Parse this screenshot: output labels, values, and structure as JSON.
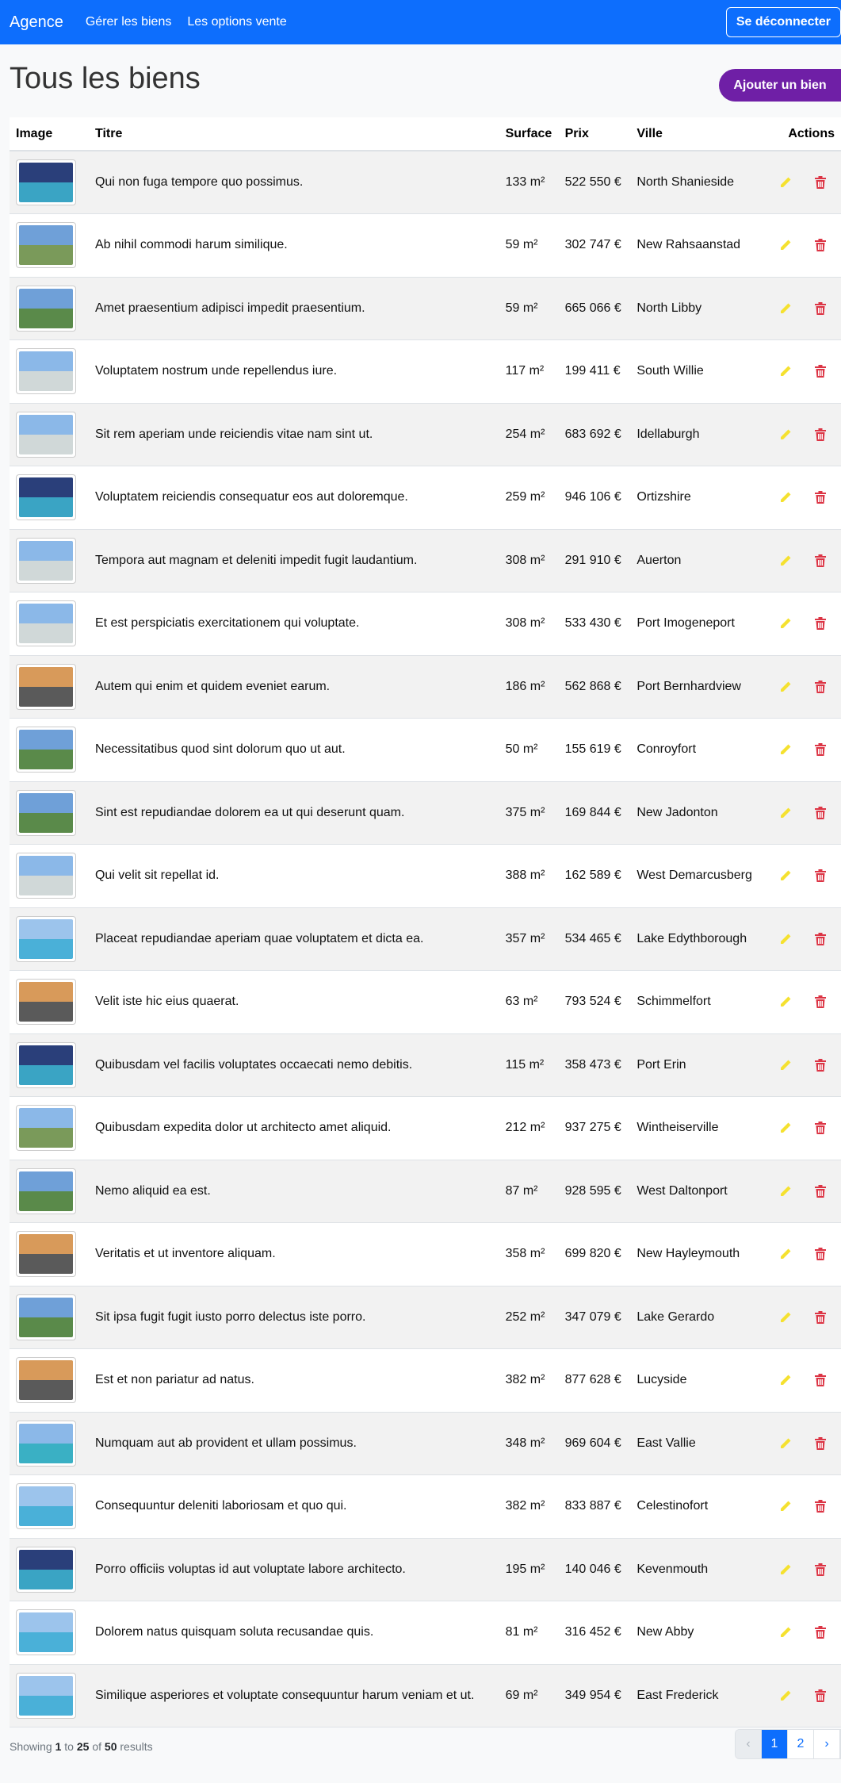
{
  "navbar": {
    "brand": "Agence",
    "links": [
      "Gérer les biens",
      "Les options vente"
    ],
    "logout_label": "Se déconnecter"
  },
  "page": {
    "title": "Tous les biens",
    "add_button": "Ajouter un bien"
  },
  "table": {
    "headers": [
      "Image",
      "Titre",
      "Surface",
      "Prix",
      "Ville",
      "Actions"
    ],
    "rows": [
      {
        "title": "Qui non fuga tempore quo possimus.",
        "surface": "133 m²",
        "price": "522 550 €",
        "city": "North Shanieside",
        "sky": "#2a3f7a",
        "ground": "#3aa4c4"
      },
      {
        "title": "Ab nihil commodi harum similique.",
        "surface": "59 m²",
        "price": "302 747 €",
        "city": "New Rahsaanstad",
        "sky": "#6fa0d8",
        "ground": "#7a9a5a"
      },
      {
        "title": "Amet praesentium adipisci impedit praesentium.",
        "surface": "59 m²",
        "price": "665 066 €",
        "city": "North Libby",
        "sky": "#6fa0d8",
        "ground": "#5a8a4a"
      },
      {
        "title": "Voluptatem nostrum unde repellendus iure.",
        "surface": "117 m²",
        "price": "199 411 €",
        "city": "South Willie",
        "sky": "#8bb8e8",
        "ground": "#d0d8d8"
      },
      {
        "title": "Sit rem aperiam unde reiciendis vitae nam sint ut.",
        "surface": "254 m²",
        "price": "683 692 €",
        "city": "Idellaburgh",
        "sky": "#8bb8e8",
        "ground": "#d0d8d8"
      },
      {
        "title": "Voluptatem reiciendis consequatur eos aut doloremque.",
        "surface": "259 m²",
        "price": "946 106 €",
        "city": "Ortizshire",
        "sky": "#2a3f7a",
        "ground": "#3aa4c4"
      },
      {
        "title": "Tempora aut magnam et deleniti impedit fugit laudantium.",
        "surface": "308 m²",
        "price": "291 910 €",
        "city": "Auerton",
        "sky": "#8bb8e8",
        "ground": "#d0d8d8"
      },
      {
        "title": "Et est perspiciatis exercitationem qui voluptate.",
        "surface": "308 m²",
        "price": "533 430 €",
        "city": "Port Imogeneport",
        "sky": "#8bb8e8",
        "ground": "#d0d8d8"
      },
      {
        "title": "Autem qui enim et quidem eveniet earum.",
        "surface": "186 m²",
        "price": "562 868 €",
        "city": "Port Bernhardview",
        "sky": "#d89a5a",
        "ground": "#5a5a5a"
      },
      {
        "title": "Necessitatibus quod sint dolorum quo ut aut.",
        "surface": "50 m²",
        "price": "155 619 €",
        "city": "Conroyfort",
        "sky": "#6fa0d8",
        "ground": "#5a8a4a"
      },
      {
        "title": "Sint est repudiandae dolorem ea ut qui deserunt quam.",
        "surface": "375 m²",
        "price": "169 844 €",
        "city": "New Jadonton",
        "sky": "#6fa0d8",
        "ground": "#5a8a4a"
      },
      {
        "title": "Qui velit sit repellat id.",
        "surface": "388 m²",
        "price": "162 589 €",
        "city": "West Demarcusberg",
        "sky": "#8bb8e8",
        "ground": "#d0d8d8"
      },
      {
        "title": "Placeat repudiandae aperiam quae voluptatem et dicta ea.",
        "surface": "357 m²",
        "price": "534 465 €",
        "city": "Lake Edythborough",
        "sky": "#9cc4ec",
        "ground": "#4ab0d8"
      },
      {
        "title": "Velit iste hic eius quaerat.",
        "surface": "63 m²",
        "price": "793 524 €",
        "city": "Schimmelfort",
        "sky": "#d89a5a",
        "ground": "#5a5a5a"
      },
      {
        "title": "Quibusdam vel facilis voluptates occaecati nemo debitis.",
        "surface": "115 m²",
        "price": "358 473 €",
        "city": "Port Erin",
        "sky": "#2a3f7a",
        "ground": "#3aa4c4"
      },
      {
        "title": "Quibusdam expedita dolor ut architecto amet aliquid.",
        "surface": "212 m²",
        "price": "937 275 €",
        "city": "Wintheiserville",
        "sky": "#8bb8e8",
        "ground": "#7a9a5a"
      },
      {
        "title": "Nemo aliquid ea est.",
        "surface": "87 m²",
        "price": "928 595 €",
        "city": "West Daltonport",
        "sky": "#6fa0d8",
        "ground": "#5a8a4a"
      },
      {
        "title": "Veritatis et ut inventore aliquam.",
        "surface": "358 m²",
        "price": "699 820 €",
        "city": "New Hayleymouth",
        "sky": "#d89a5a",
        "ground": "#5a5a5a"
      },
      {
        "title": "Sit ipsa fugit fugit iusto porro delectus iste porro.",
        "surface": "252 m²",
        "price": "347 079 €",
        "city": "Lake Gerardo",
        "sky": "#6fa0d8",
        "ground": "#5a8a4a"
      },
      {
        "title": "Est et non pariatur ad natus.",
        "surface": "382 m²",
        "price": "877 628 €",
        "city": "Lucyside",
        "sky": "#d89a5a",
        "ground": "#5a5a5a"
      },
      {
        "title": "Numquam aut ab provident et ullam possimus.",
        "surface": "348 m²",
        "price": "969 604 €",
        "city": "East Vallie",
        "sky": "#8bb8e8",
        "ground": "#3ab0c4"
      },
      {
        "title": "Consequuntur deleniti laboriosam et quo qui.",
        "surface": "382 m²",
        "price": "833 887 €",
        "city": "Celestinofort",
        "sky": "#9cc4ec",
        "ground": "#4ab0d8"
      },
      {
        "title": "Porro officiis voluptas id aut voluptate labore architecto.",
        "surface": "195 m²",
        "price": "140 046 €",
        "city": "Kevenmouth",
        "sky": "#2a3f7a",
        "ground": "#3aa4c4"
      },
      {
        "title": "Dolorem natus quisquam soluta recusandae quis.",
        "surface": "81 m²",
        "price": "316 452 €",
        "city": "New Abby",
        "sky": "#9cc4ec",
        "ground": "#4ab0d8"
      },
      {
        "title": "Similique asperiores et voluptate consequuntur harum veniam et ut.",
        "surface": "69 m²",
        "price": "349 954 €",
        "city": "East Frederick",
        "sky": "#9cc4ec",
        "ground": "#4ab0d8"
      }
    ]
  },
  "pagination": {
    "showing": "Showing",
    "from": "1",
    "to_word": "to",
    "to": "25",
    "of_word": "of",
    "total": "50",
    "results_word": "results",
    "prev": "‹",
    "pages": [
      "1",
      "2"
    ],
    "next": "›"
  },
  "colors": {
    "navbar": "#0d6efd",
    "add_button": "#6f1fa6",
    "edit_icon": "#f5e130",
    "delete_icon": "#dc3545"
  },
  "icons": {
    "edit": "pencil-icon",
    "delete": "trash-icon"
  }
}
